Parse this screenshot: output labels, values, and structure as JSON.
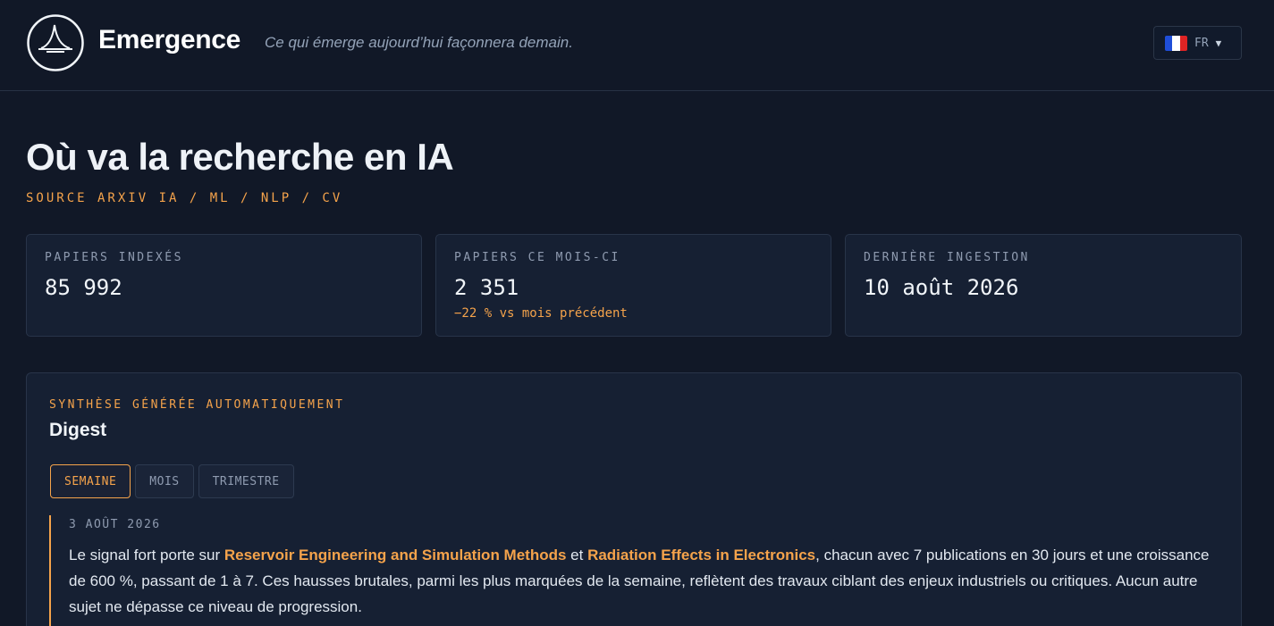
{
  "header": {
    "brand": "Emergence",
    "tagline": "Ce qui émerge aujourd’hui façonnera demain.",
    "language": {
      "code": "FR",
      "icon": "france-flag-icon"
    }
  },
  "page": {
    "title": "Où va la recherche en IA",
    "source": "SOURCE ARXIV IA / ML / NLP / CV"
  },
  "stats": [
    {
      "label": "PAPIERS INDEXÉS",
      "value": "85 992",
      "delta": ""
    },
    {
      "label": "PAPIERS CE MOIS-CI",
      "value": "2 351",
      "delta": "−22 % vs mois précédent"
    },
    {
      "label": "DERNIÈRE INGESTION",
      "value": "10 août 2026",
      "delta": ""
    }
  ],
  "digest": {
    "kicker": "SYNTHÈSE GÉNÉRÉE AUTOMATIQUEMENT",
    "title": "Digest",
    "tabs": [
      "SEMAINE",
      "MOIS",
      "TRIMESTRE"
    ],
    "active_tab": "SEMAINE",
    "entry": {
      "date": "3 AOÛT 2026",
      "text_intro": "Le signal fort porte sur ",
      "topic_1": "Reservoir Engineering and Simulation Methods",
      "text_and": " et ",
      "topic_2": "Radiation Effects in Electronics",
      "text_rest": ", chacun avec 7 publications en 30 jours et une croissance de 600 %, passant de 1 à 7. Ces hausses brutales, parmi les plus marquées de la semaine, reflètent des travaux ciblant des enjeux industriels ou critiques. Aucun autre sujet ne dépasse ce niveau de progression."
    }
  },
  "colors": {
    "background": "#111827",
    "card": "#162033",
    "accent": "#f5a34b",
    "muted": "#8f9bb0"
  }
}
